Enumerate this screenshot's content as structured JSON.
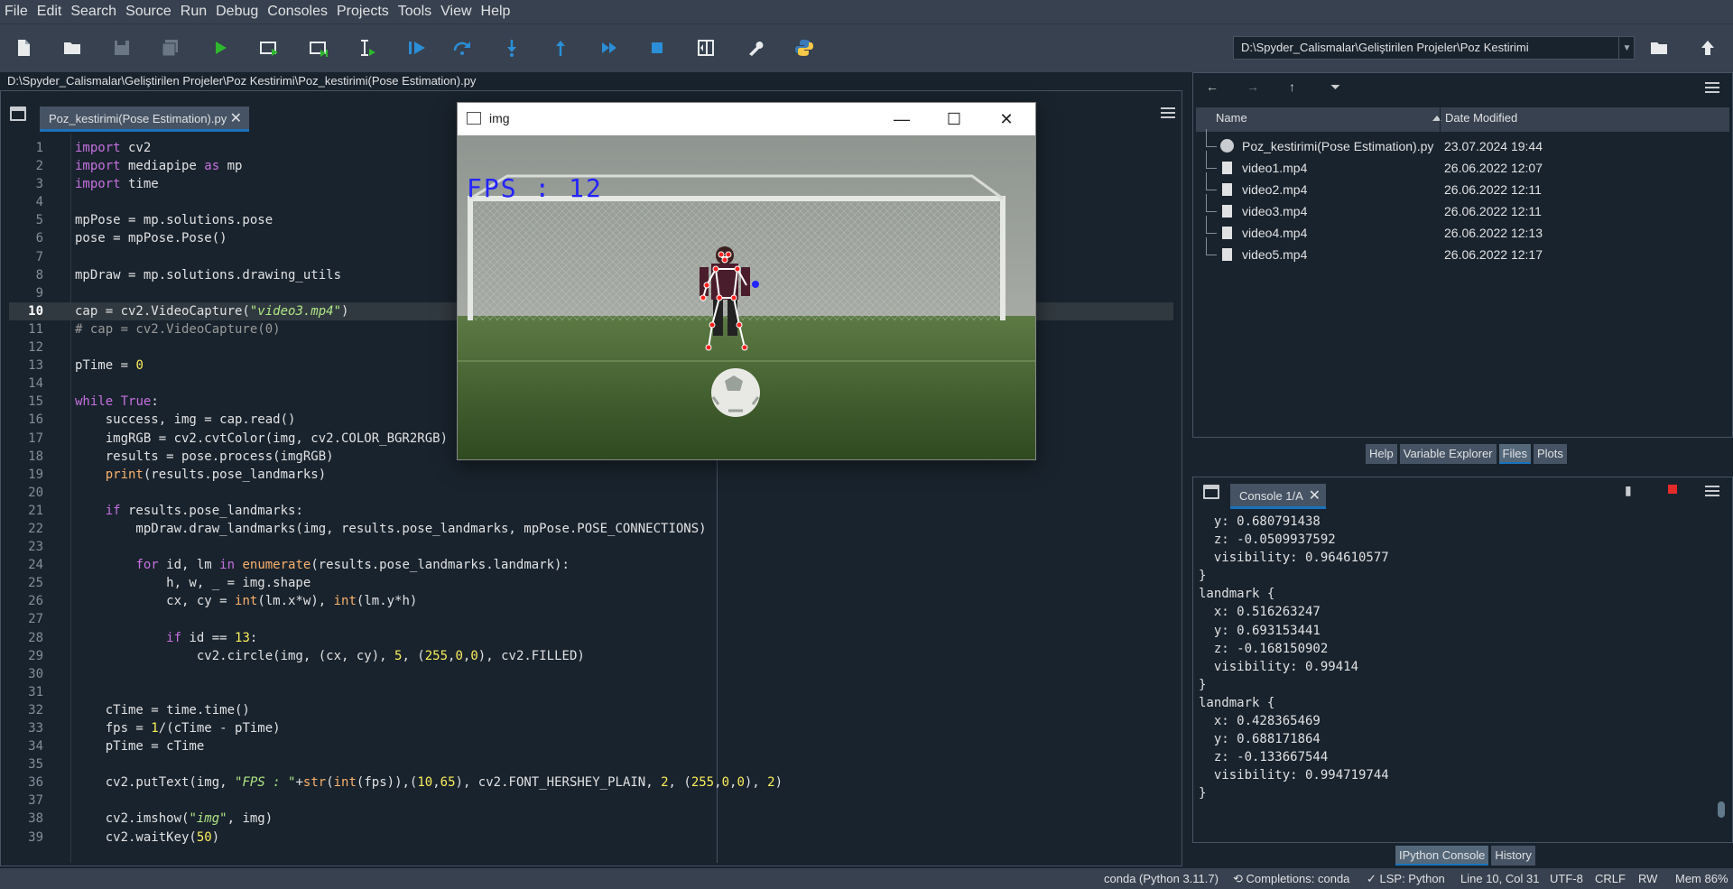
{
  "menu": [
    "File",
    "Edit",
    "Search",
    "Source",
    "Run",
    "Debug",
    "Consoles",
    "Projects",
    "Tools",
    "View",
    "Help"
  ],
  "toolbar": {
    "working_dir": "D:\\Spyder_Calismalar\\Geliştirilen Projeler\\Poz Kestirimi"
  },
  "editor": {
    "file_path": "D:\\Spyder_Calismalar\\Geliştirilen Projeler\\Poz Kestirimi\\Poz_kestirimi(Pose Estimation).py",
    "tab_label": "Poz_kestirimi(Pose Estimation).py",
    "current_line": 10,
    "lines": [
      "import cv2",
      "import mediapipe as mp",
      "import time",
      "",
      "mpPose = mp.solutions.pose",
      "pose = mpPose.Pose()",
      "",
      "mpDraw = mp.solutions.drawing_utils",
      "",
      "cap = cv2.VideoCapture(\"video3.mp4\")",
      "# cap = cv2.VideoCapture(0)",
      "",
      "pTime = 0",
      "",
      "while True:",
      "    success, img = cap.read()",
      "    imgRGB = cv2.cvtColor(img, cv2.COLOR_BGR2RGB)",
      "    results = pose.process(imgRGB)",
      "    print(results.pose_landmarks)",
      "",
      "    if results.pose_landmarks:",
      "        mpDraw.draw_landmarks(img, results.pose_landmarks, mpPose.POSE_CONNECTIONS)",
      "",
      "        for id, lm in enumerate(results.pose_landmarks.landmark):",
      "            h, w, _ = img.shape",
      "            cx, cy = int(lm.x*w), int(lm.y*h)",
      "",
      "            if id == 13:",
      "                cv2.circle(img, (cx, cy), 5, (255,0,0), cv2.FILLED)",
      "",
      "",
      "    cTime = time.time()",
      "    fps = 1/(cTime - pTime)",
      "    pTime = cTime",
      "",
      "    cv2.putText(img, \"FPS : \"+str(int(fps)),(10,65), cv2.FONT_HERSHEY_PLAIN, 2, (255,0,0), 2)",
      "",
      "    cv2.imshow(\"img\", img)",
      "    cv2.waitKey(50)"
    ]
  },
  "image_window": {
    "title": "img",
    "fps_text": "FPS : 12"
  },
  "files": {
    "col_name": "Name",
    "col_date": "Date Modified",
    "items": [
      {
        "name": "Poz_kestirimi(Pose Estimation).py",
        "date": "23.07.2024 19:44",
        "type": "py"
      },
      {
        "name": "video1.mp4",
        "date": "26.06.2022 12:07",
        "type": "file"
      },
      {
        "name": "video2.mp4",
        "date": "26.06.2022 12:11",
        "type": "file"
      },
      {
        "name": "video3.mp4",
        "date": "26.06.2022 12:11",
        "type": "file"
      },
      {
        "name": "video4.mp4",
        "date": "26.06.2022 12:13",
        "type": "file"
      },
      {
        "name": "video5.mp4",
        "date": "26.06.2022 12:17",
        "type": "file"
      }
    ]
  },
  "pane_tabs": [
    "Help",
    "Variable Explorer",
    "Files",
    "Plots"
  ],
  "pane_tabs_active": "Files",
  "console": {
    "tab_label": "Console 1/A",
    "lines": [
      "  y: 0.680791438",
      "  z: -0.0509937592",
      "  visibility: 0.964610577",
      "}",
      "landmark {",
      "  x: 0.516263247",
      "  y: 0.693153441",
      "  z: -0.168150902",
      "  visibility: 0.99414",
      "}",
      "landmark {",
      "  x: 0.428365469",
      "  y: 0.688171864",
      "  z: -0.133667544",
      "  visibility: 0.994719744",
      "}"
    ]
  },
  "console_tabs": [
    "IPython Console",
    "History"
  ],
  "console_tabs_active": "IPython Console",
  "status": {
    "env": "conda (Python 3.11.7)",
    "completions": "Completions: conda",
    "lsp": "LSP: Python",
    "position": "Line 10, Col 31",
    "encoding": "UTF-8",
    "eol": "CRLF",
    "rw": "RW",
    "mem": "Mem 86%"
  }
}
